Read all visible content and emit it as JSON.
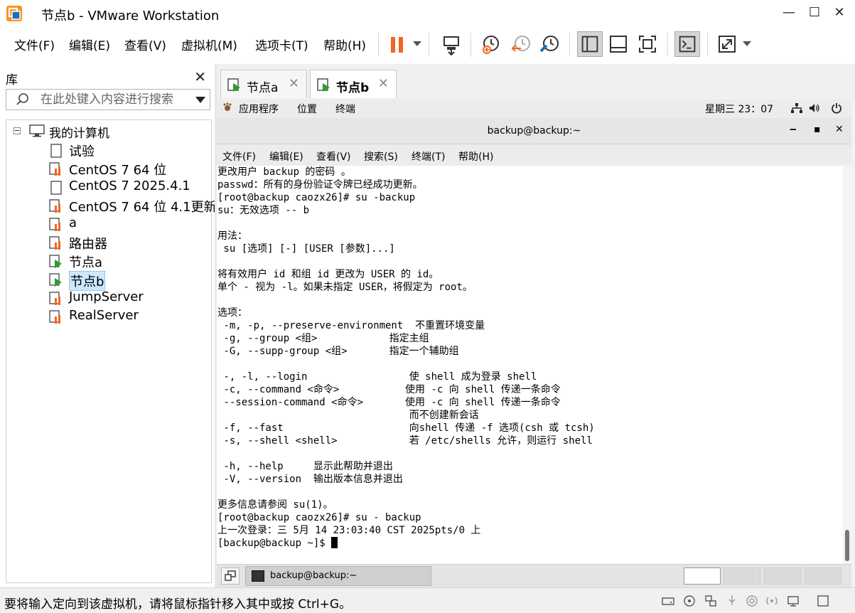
{
  "window": {
    "title": "节点b - VMware Workstation",
    "controls": {
      "minimize": "—",
      "maximize": "☐",
      "close": "✕"
    }
  },
  "menubar": {
    "items": [
      "文件(F)",
      "编辑(E)",
      "查看(V)",
      "虚拟机(M)",
      "选项卡(T)",
      "帮助(H)"
    ]
  },
  "toolbar": {
    "buttons": [
      "pause",
      "send-ctrl-alt-del",
      "snapshot-take",
      "snapshot-revert",
      "snapshot-manager",
      "library-view",
      "console-view",
      "fullscreen",
      "terminal",
      "stretch"
    ],
    "accent": "#f26522"
  },
  "library": {
    "title": "库",
    "close": "✕",
    "search_placeholder": "在此处键入内容进行搜索",
    "root": "我的计算机",
    "items": [
      {
        "label": "试验",
        "state": "off-blank"
      },
      {
        "label": "CentOS 7 64 位",
        "state": "off"
      },
      {
        "label": "CentOS 7 2025.4.1",
        "state": "off-blank"
      },
      {
        "label": "CentOS 7 64 位 4.1更新",
        "state": "off"
      },
      {
        "label": "a",
        "state": "off"
      },
      {
        "label": "路由器",
        "state": "off"
      },
      {
        "label": "节点a",
        "state": "running"
      },
      {
        "label": "节点b",
        "state": "running"
      },
      {
        "label": "JumpServer",
        "state": "off"
      },
      {
        "label": "RealServer",
        "state": "off"
      }
    ],
    "selected": "节点b"
  },
  "tabs": [
    {
      "label": "节点a",
      "close": "✕"
    },
    {
      "label": "节点b",
      "close": "✕"
    }
  ],
  "guest": {
    "topbar": {
      "apps": "应用程序",
      "places": "位置",
      "terminal": "终端",
      "clock": "星期三 23：07"
    },
    "terminal_window": {
      "title": "backup@backup:~",
      "controls": {
        "minimize": "‒",
        "maximize": "▪",
        "close": "✕"
      },
      "menu": [
        "文件(F)",
        "编辑(E)",
        "查看(V)",
        "搜索(S)",
        "终端(T)",
        "帮助(H)"
      ],
      "lines": [
        "更改用户 backup 的密码 。",
        "passwd：所有的身份验证令牌已经成功更新。",
        "[root@backup caozx26]# su -backup",
        "su：无效选项 -- b",
        "",
        "用法：",
        " su [选项] [-] [USER [参数]...]",
        "",
        "将有效用户 id 和组 id 更改为 USER 的 id。",
        "单个 - 视为 -l。如果未指定 USER，将假定为 root。",
        "",
        "选项：",
        " -m, -p, --preserve-environment  不重置环境变量",
        " -g, --group <组>            指定主组",
        " -G, --supp-group <组>       指定一个辅助组",
        "",
        " -, -l, --login                 使 shell 成为登录 shell",
        " -c, --command <命令>           使用 -c 向 shell 传递一条命令",
        " --session-command <命令>       使用 -c 向 shell 传递一条命令",
        "                                而不创建新会话",
        " -f, --fast                     向shell 传递 -f 选项(csh 或 tcsh)",
        " -s, --shell <shell>            若 /etc/shells 允许，则运行 shell",
        "",
        " -h, --help     显示此帮助并退出",
        " -V, --version  输出版本信息并退出",
        "",
        "更多信息请参阅 su(1)。",
        "[root@backup caozx26]# su - backup",
        "上一次登录：三 5月 14 23:03:40 CST 2025pts/0 上",
        "[backup@backup ~]$ "
      ]
    },
    "taskbar": {
      "task_label": "backup@backup:~",
      "workspaces": 4,
      "active_workspace": 1
    }
  },
  "statusbar": {
    "text": "要将输入定向到该虚拟机，请将鼠标指针移入其中或按 Ctrl+G。"
  }
}
